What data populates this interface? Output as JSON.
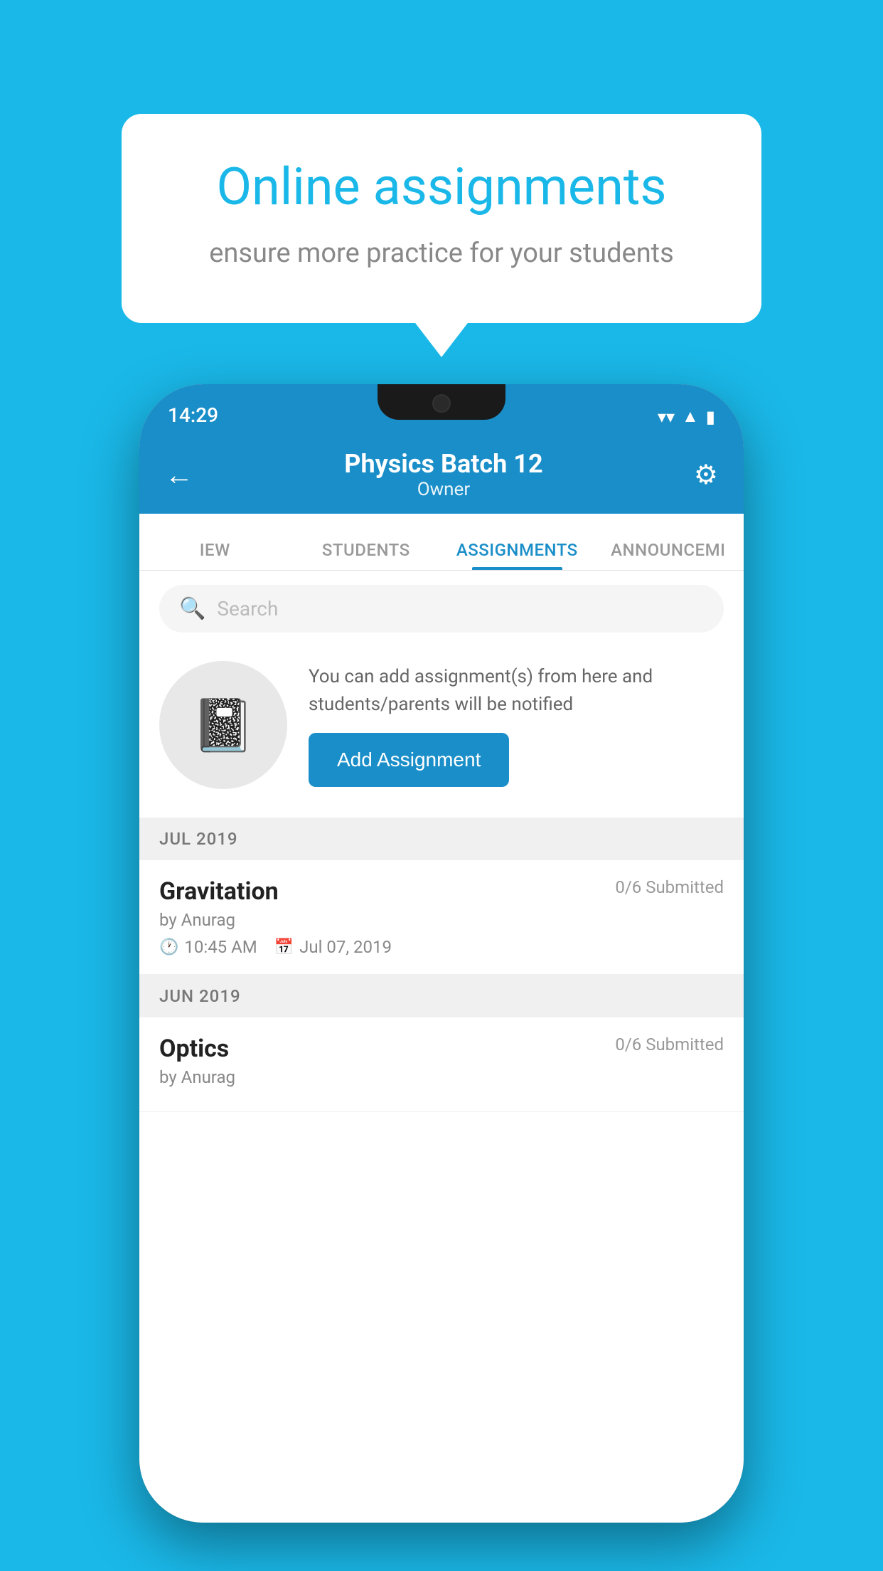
{
  "background_color": "#1ab8e8",
  "promo": {
    "title": "Online assignments",
    "subtitle": "ensure more practice for your students"
  },
  "phone": {
    "status_bar": {
      "time": "14:29",
      "wifi_icon": "▾",
      "signal_icon": "▲",
      "battery_icon": "▮"
    },
    "header": {
      "title": "Physics Batch 12",
      "subtitle": "Owner",
      "back_label": "←",
      "settings_label": "⚙"
    },
    "tabs": [
      {
        "id": "overview",
        "label": "IEW"
      },
      {
        "id": "students",
        "label": "STUDENTS"
      },
      {
        "id": "assignments",
        "label": "ASSIGNMENTS",
        "active": true
      },
      {
        "id": "announcements",
        "label": "ANNOUNCEMI"
      }
    ],
    "search": {
      "placeholder": "Search"
    },
    "add_section": {
      "description": "You can add assignment(s) from here and students/parents will be notified",
      "button_label": "Add Assignment"
    },
    "sections": [
      {
        "month": "JUL 2019",
        "assignments": [
          {
            "name": "Gravitation",
            "submitted": "0/6 Submitted",
            "by": "by Anurag",
            "time": "10:45 AM",
            "date": "Jul 07, 2019"
          }
        ]
      },
      {
        "month": "JUN 2019",
        "assignments": [
          {
            "name": "Optics",
            "submitted": "0/6 Submitted",
            "by": "by Anurag",
            "time": "",
            "date": ""
          }
        ]
      }
    ]
  }
}
